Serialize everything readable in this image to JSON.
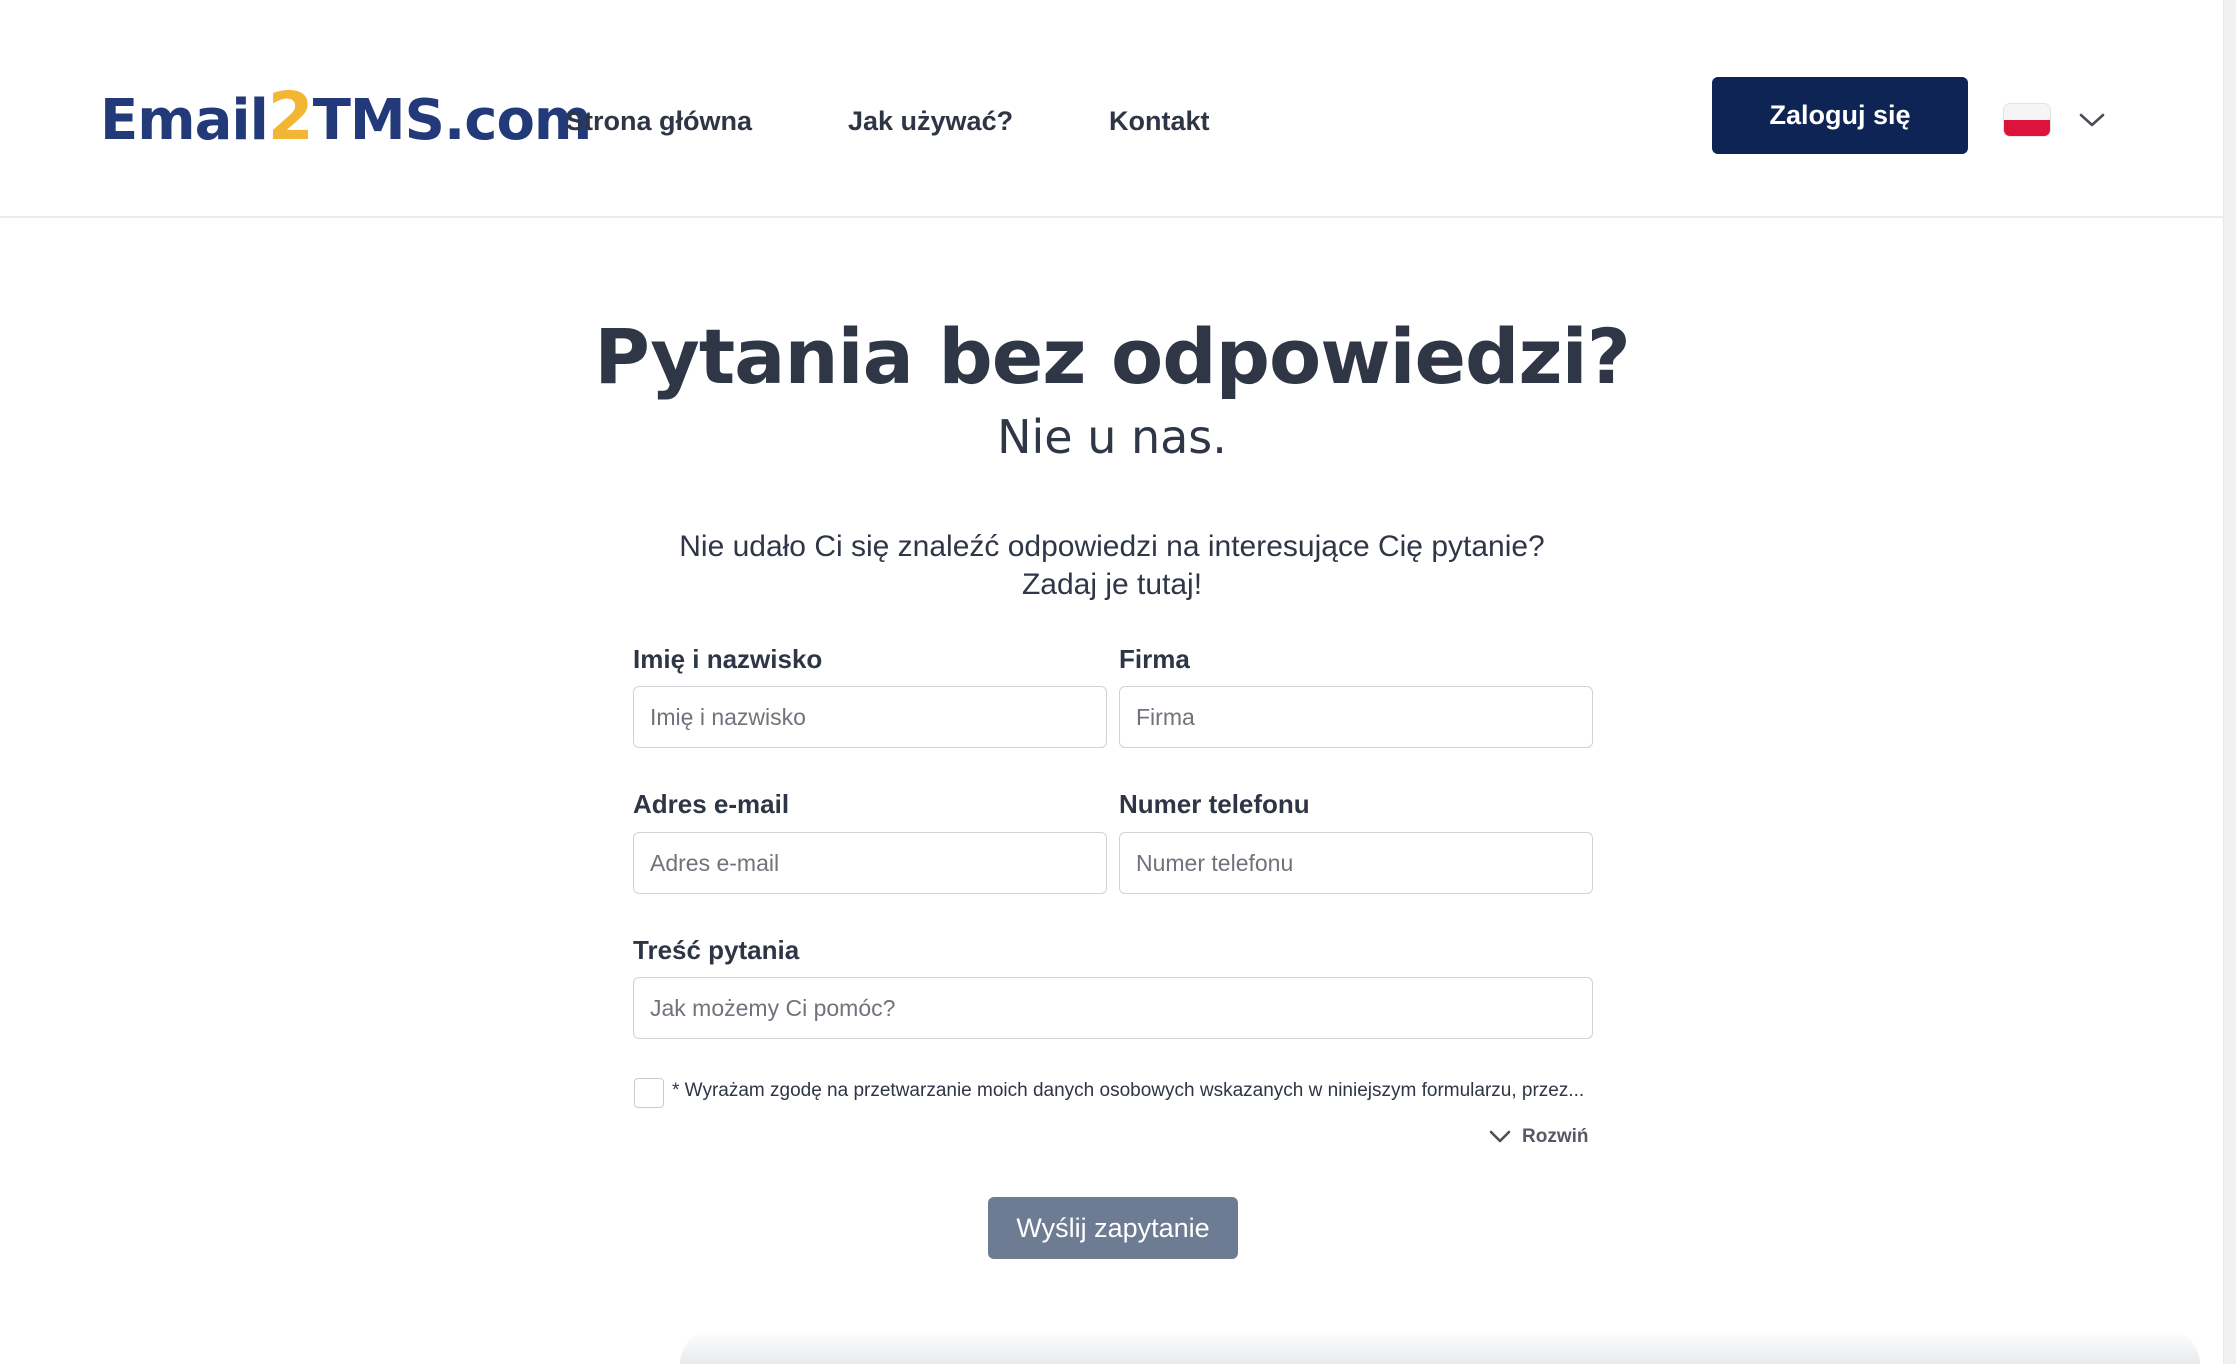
{
  "header": {
    "logo": {
      "part1": "Email",
      "part2": "2",
      "part3": "TMS.com"
    },
    "nav": [
      {
        "label": "Strona główna"
      },
      {
        "label": "Jak używać?"
      },
      {
        "label": "Kontakt"
      }
    ],
    "login_label": "Zaloguj się",
    "language": {
      "flag": "poland-flag-icon",
      "dropdown_icon": "chevron-down-icon"
    }
  },
  "hero": {
    "title": "Pytania bez odpowiedzi?",
    "subtitle": "Nie u nas.",
    "intro_line1": "Nie udało Ci się znaleźć odpowiedzi na interesujące Cię pytanie?",
    "intro_line2": "Zadaj je tutaj!"
  },
  "form": {
    "name": {
      "label": "Imię i nazwisko",
      "placeholder": "Imię i nazwisko",
      "value": ""
    },
    "company": {
      "label": "Firma",
      "placeholder": "Firma",
      "value": ""
    },
    "email": {
      "label": "Adres e-mail",
      "placeholder": "Adres e-mail",
      "value": ""
    },
    "phone": {
      "label": "Numer telefonu",
      "placeholder": "Numer telefonu",
      "value": ""
    },
    "message": {
      "label": "Treść pytania",
      "placeholder": "Jak możemy Ci pomóc?",
      "value": ""
    },
    "consent_text": "* Wyrażam zgodę na przetwarzanie moich danych osobowych wskazanych w niniejszym formularzu, przez...",
    "expand_label": "Rozwiń",
    "submit_label": "Wyślij zapytanie"
  },
  "colors": {
    "brand_navy": "#0d2455",
    "logo_blue": "#233a7a",
    "logo_accent": "#f2b534",
    "submit_disabled": "#6d7b93"
  }
}
